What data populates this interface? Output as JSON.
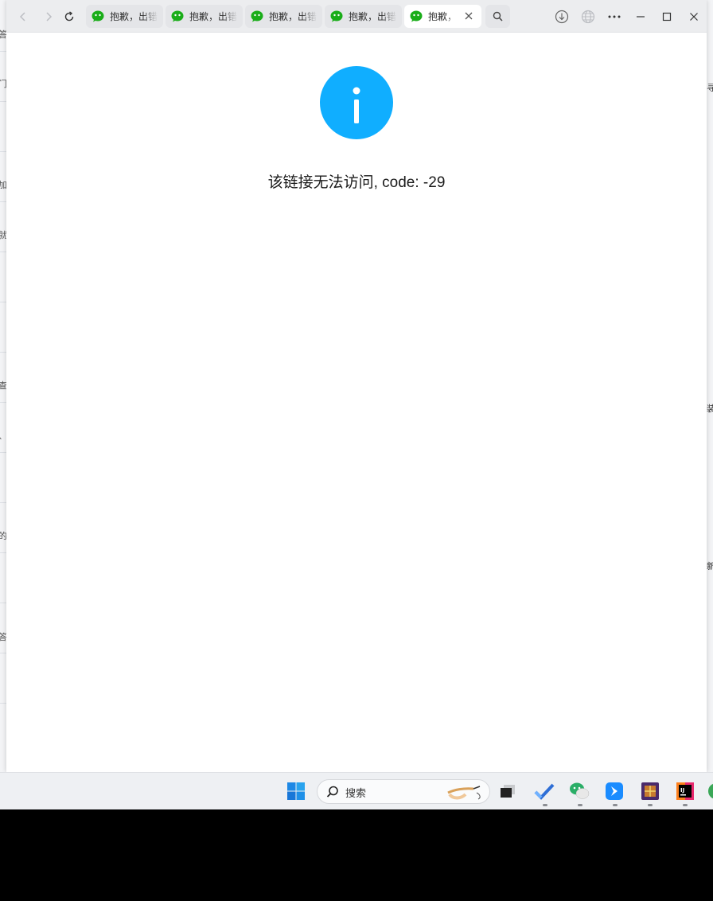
{
  "browser": {
    "tabs": [
      {
        "label": "抱歉，出错了",
        "current": false
      },
      {
        "label": "抱歉，出错了",
        "current": false
      },
      {
        "label": "抱歉，出错了",
        "current": false
      },
      {
        "label": "抱歉，出错了",
        "current": false
      },
      {
        "label": "抱歉，",
        "current": true
      }
    ],
    "icons": {
      "back": "back-arrow-icon",
      "forward": "forward-arrow-icon",
      "refresh": "refresh-icon",
      "search": "search-icon",
      "download": "download-icon",
      "globe": "globe-icon",
      "more": "more-icon",
      "minimize": "minimize-icon",
      "maximize": "maximize-icon",
      "close": "close-icon"
    }
  },
  "page": {
    "message": "该链接无法访问, code: -29"
  },
  "taskbar": {
    "search_placeholder": "搜索"
  },
  "background_edge": {
    "left_chars": [
      "答",
      "门",
      "加",
      "就",
      "查",
      "、看",
      "的",
      "答"
    ],
    "right_chars": [
      "寻",
      "装",
      "新"
    ]
  },
  "colors": {
    "info_blue": "#10aeff",
    "wechat_green": "#1aad19"
  }
}
